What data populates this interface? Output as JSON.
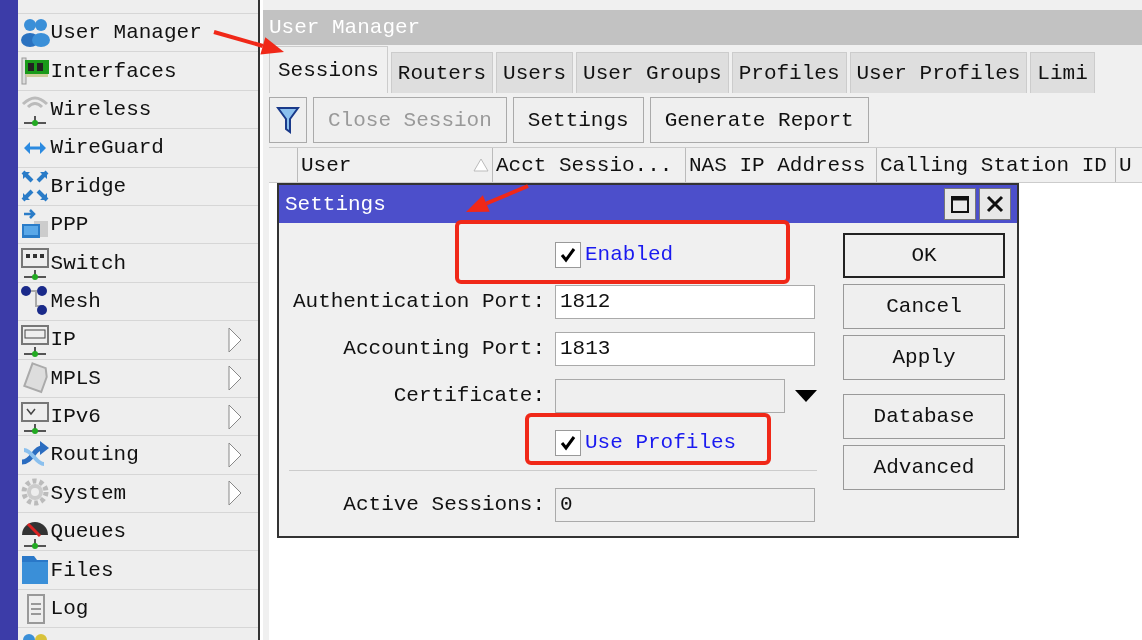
{
  "sidebar": {
    "items": [
      {
        "label": "User Manager",
        "submenu": false
      },
      {
        "label": "Interfaces",
        "submenu": false
      },
      {
        "label": "Wireless",
        "submenu": false
      },
      {
        "label": "WireGuard",
        "submenu": false
      },
      {
        "label": "Bridge",
        "submenu": false
      },
      {
        "label": "PPP",
        "submenu": false
      },
      {
        "label": "Switch",
        "submenu": false
      },
      {
        "label": "Mesh",
        "submenu": false
      },
      {
        "label": "IP",
        "submenu": true
      },
      {
        "label": "MPLS",
        "submenu": true
      },
      {
        "label": "IPv6",
        "submenu": true
      },
      {
        "label": "Routing",
        "submenu": true
      },
      {
        "label": "System",
        "submenu": true
      },
      {
        "label": "Queues",
        "submenu": false
      },
      {
        "label": "Files",
        "submenu": false
      },
      {
        "label": "Log",
        "submenu": false
      }
    ]
  },
  "window": {
    "title": "User Manager"
  },
  "tabs": [
    {
      "label": "Sessions",
      "selected": true
    },
    {
      "label": "Routers",
      "selected": false
    },
    {
      "label": "Users",
      "selected": false
    },
    {
      "label": "User Groups",
      "selected": false
    },
    {
      "label": "Profiles",
      "selected": false
    },
    {
      "label": "User Profiles",
      "selected": false
    },
    {
      "label": "Limi",
      "selected": false
    }
  ],
  "toolbar": {
    "buttons": [
      {
        "kind": "filter",
        "disabled": false
      },
      {
        "kind": "text",
        "label": "Close Session",
        "disabled": true
      },
      {
        "kind": "text",
        "label": "Settings",
        "disabled": false
      },
      {
        "kind": "text",
        "label": "Generate Report",
        "disabled": false
      }
    ]
  },
  "table": {
    "columns": [
      {
        "label": "User",
        "sorted": true
      },
      {
        "label": "Acct Sessio...",
        "sorted": false
      },
      {
        "label": "NAS IP Address",
        "sorted": false
      },
      {
        "label": "Calling Station ID",
        "sorted": false
      },
      {
        "label": "U",
        "sorted": false
      }
    ]
  },
  "dialog": {
    "title": "Settings",
    "fields": [
      {
        "kind": "checkbox",
        "label": "Enabled",
        "checked": true,
        "highlighted": true
      },
      {
        "kind": "text",
        "label": "Authentication Port:",
        "value": "1812"
      },
      {
        "kind": "text",
        "label": "Accounting Port:",
        "value": "1813"
      },
      {
        "kind": "select",
        "label": "Certificate:"
      },
      {
        "kind": "checkbox",
        "label": "Use Profiles",
        "checked": true,
        "highlighted": true
      },
      {
        "kind": "separator"
      },
      {
        "kind": "readonly",
        "label": "Active Sessions:",
        "value": "0"
      }
    ],
    "buttons": [
      {
        "label": "OK",
        "default": true
      },
      {
        "label": "Cancel",
        "default": false
      },
      {
        "label": "Apply",
        "default": false
      },
      {
        "label": "Database",
        "default": false
      },
      {
        "label": "Advanced",
        "default": false
      }
    ]
  },
  "annotations": {
    "arrow_to_window": true,
    "arrow_to_dialog": true
  }
}
